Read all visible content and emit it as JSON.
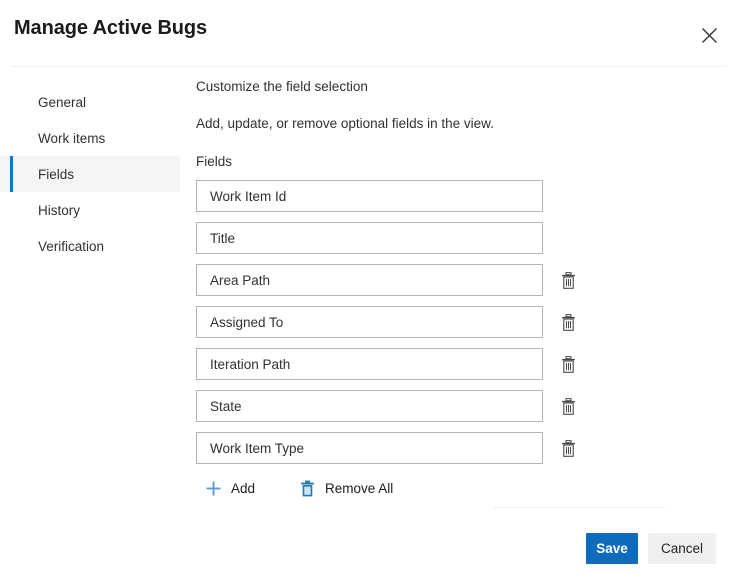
{
  "dialog": {
    "title": "Manage Active Bugs",
    "close_label": "Close",
    "close_icon": "close-icon"
  },
  "sidebar": {
    "items": [
      {
        "label": "General",
        "selected": false
      },
      {
        "label": "Work items",
        "selected": false
      },
      {
        "label": "Fields",
        "selected": true
      },
      {
        "label": "History",
        "selected": false
      },
      {
        "label": "Verification",
        "selected": false
      }
    ]
  },
  "main": {
    "heading": "Customize the field selection",
    "subheading": "Add, update, or remove optional fields in the view.",
    "fields_label": "Fields",
    "fields": [
      {
        "value": "Work Item Id",
        "deletable": false
      },
      {
        "value": "Title",
        "deletable": false
      },
      {
        "value": "Area Path",
        "deletable": true
      },
      {
        "value": "Assigned To",
        "deletable": true
      },
      {
        "value": "Iteration Path",
        "deletable": true
      },
      {
        "value": "State",
        "deletable": true
      },
      {
        "value": "Work Item Type",
        "deletable": true
      }
    ],
    "delete_icon": "trash-icon",
    "actions": {
      "add_label": "Add",
      "add_icon": "plus-icon",
      "remove_all_label": "Remove All",
      "remove_all_icon": "trash-icon"
    }
  },
  "footer": {
    "save_label": "Save",
    "cancel_label": "Cancel"
  },
  "colors": {
    "accent": "#0f6cbd",
    "selection_bar": "#0f79c4",
    "add_icon": "#5b9bd5",
    "remove_icon": "#0f7fc4",
    "input_border": "#b5b5b5",
    "selected_row_bg": "#f5f5f5"
  }
}
